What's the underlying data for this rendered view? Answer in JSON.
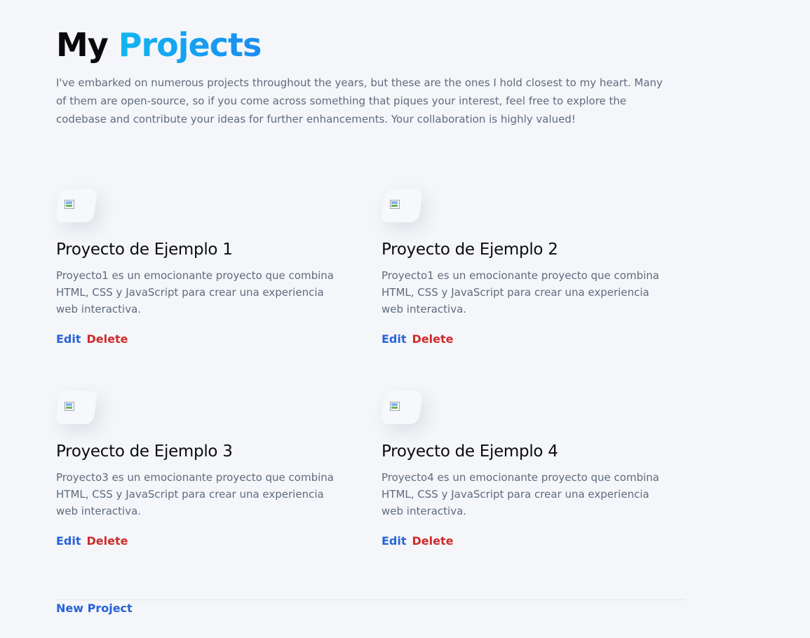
{
  "header": {
    "title_plain": "My",
    "title_accent": "Projects",
    "intro": "I've embarked on numerous projects throughout the years, but these are the ones I hold closest to my heart. Many of them are open-source, so if you come across something that piques your interest, feel free to explore the codebase and contribute your ideas for further enhancements. Your collaboration is highly valued!"
  },
  "colors": {
    "accent_start": "#12b6f0",
    "accent_end": "#1a8cf0",
    "edit": "#2762d9",
    "delete": "#cf2a2a",
    "background": "#f4f6f9"
  },
  "projects": [
    {
      "title": "Proyecto de Ejemplo 1",
      "description": "Proyecto1 es un emocionante proyecto que combina HTML, CSS y JavaScript para crear una experiencia web interactiva.",
      "image_icon": "broken-image-icon",
      "edit_label": "Edit",
      "delete_label": "Delete"
    },
    {
      "title": "Proyecto de Ejemplo 2",
      "description": "Proyecto1 es un emocionante proyecto que combina HTML, CSS y JavaScript para crear una experiencia web interactiva.",
      "image_icon": "broken-image-icon",
      "edit_label": "Edit",
      "delete_label": "Delete"
    },
    {
      "title": "Proyecto de Ejemplo 3",
      "description": "Proyecto3 es un emocionante proyecto que combina HTML, CSS y JavaScript para crear una experiencia web interactiva.",
      "image_icon": "broken-image-icon",
      "edit_label": "Edit",
      "delete_label": "Delete"
    },
    {
      "title": "Proyecto de Ejemplo 4",
      "description": "Proyecto4 es un emocionante proyecto que combina HTML, CSS y JavaScript para crear una experiencia web interactiva.",
      "image_icon": "broken-image-icon",
      "edit_label": "Edit",
      "delete_label": "Delete"
    }
  ],
  "footer": {
    "new_project_label": "New Project"
  }
}
